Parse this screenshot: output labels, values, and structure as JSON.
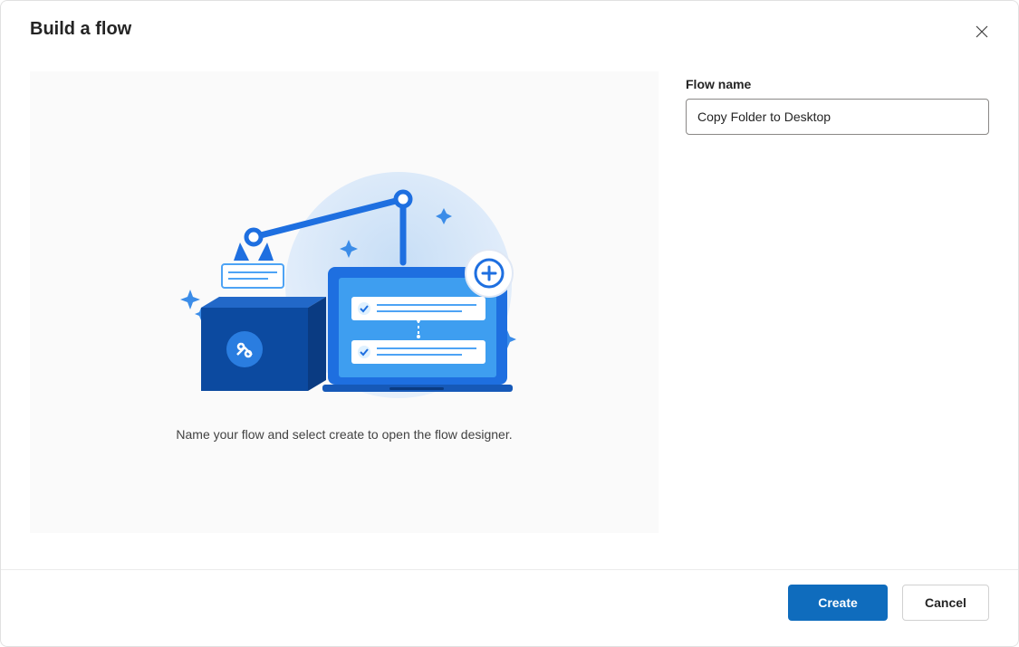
{
  "dialog": {
    "title": "Build a flow",
    "caption": "Name your flow and select create to open the flow designer."
  },
  "form": {
    "flow_name_label": "Flow name",
    "flow_name_value": "Copy Folder to Desktop"
  },
  "footer": {
    "create_label": "Create",
    "cancel_label": "Cancel"
  },
  "colors": {
    "primary": "#0f6cbd",
    "primary_dark": "#0c59a1"
  }
}
